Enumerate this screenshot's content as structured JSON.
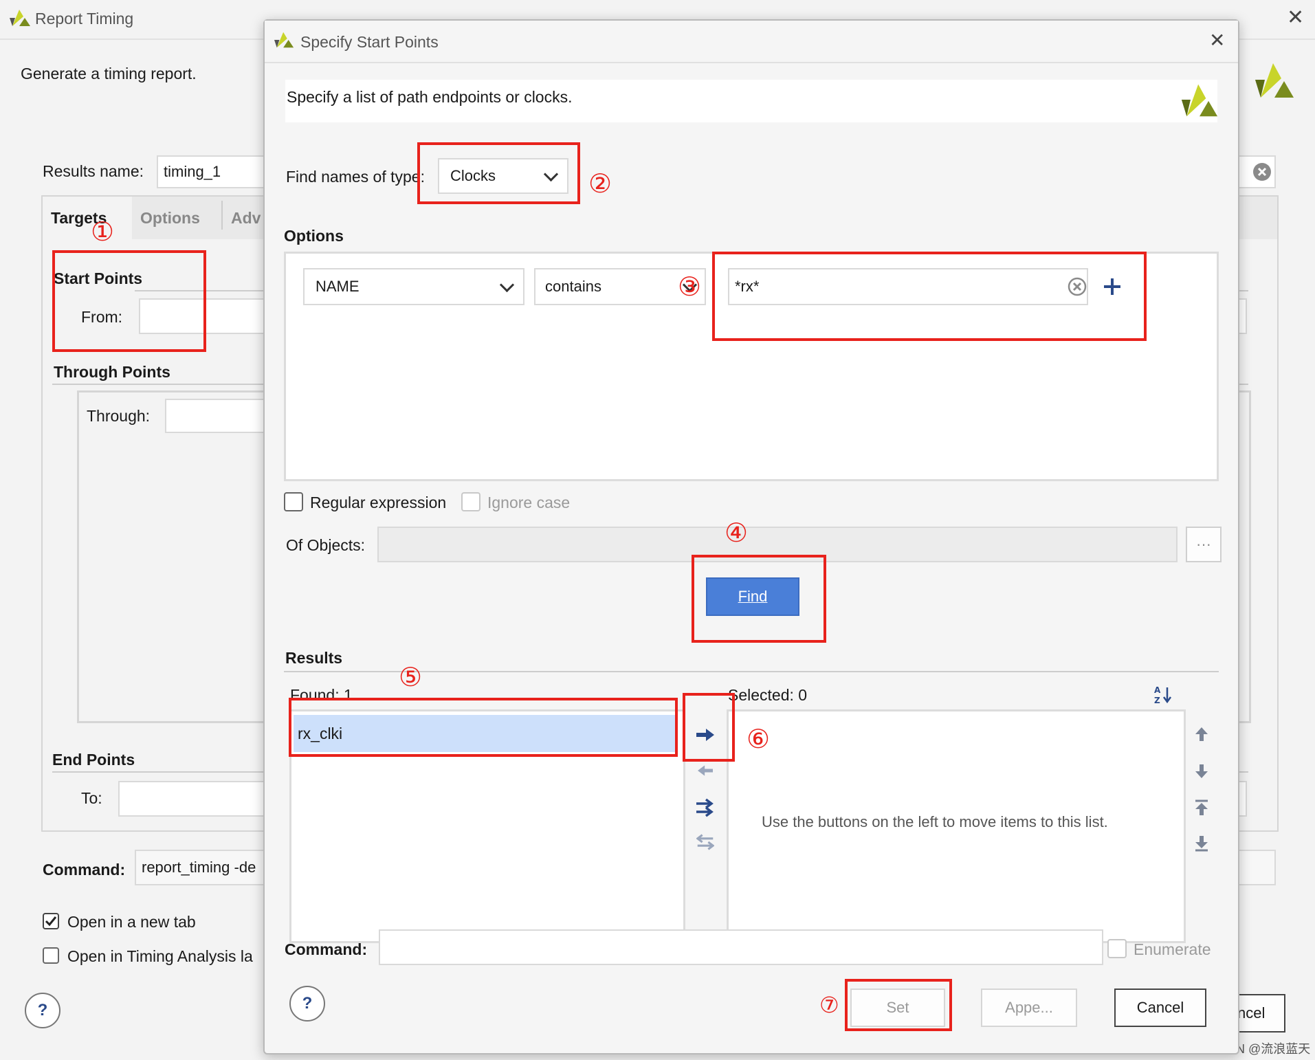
{
  "bg_dialog": {
    "title": "Report Timing",
    "description": "Generate a timing report.",
    "results_name_label": "Results name:",
    "results_name_value": "timing_1",
    "tabs": [
      {
        "label": "Targets"
      },
      {
        "label": "Options"
      },
      {
        "label": "Adv"
      }
    ],
    "start_points_heading": "Start Points",
    "from_label": "From:",
    "through_points_heading": "Through Points",
    "through_label": "Through:",
    "end_points_heading": "End Points",
    "to_label": "To:",
    "command_label": "Command:",
    "command_value": "report_timing -de",
    "open_new_tab_label": "Open in a new tab",
    "open_new_tab_checked": true,
    "open_timing_label": "Open in Timing Analysis la",
    "open_timing_checked": false,
    "help_label": "?",
    "cancel_label": "ncel"
  },
  "dialog": {
    "title": "Specify Start Points",
    "description": "Specify a list of path endpoints or clocks.",
    "find_type_label": "Find names of type:",
    "find_type_value": "Clocks",
    "options_heading": "Options",
    "property_value": "NAME",
    "operator_value": "contains",
    "pattern_value": "*rx*",
    "regex_label": "Regular expression",
    "ignore_case_label": "Ignore case",
    "of_objects_label": "Of Objects:",
    "of_objects_browse": "···",
    "find_label": "Find",
    "results_heading": "Results",
    "found_label": "Found: 1",
    "found_items": [
      {
        "name": "rx_clki"
      }
    ],
    "selected_label": "Selected: 0",
    "selected_placeholder": "Use the buttons on the left to move items to this list.",
    "command_label": "Command:",
    "command_value": "",
    "enumerate_label": "Enumerate",
    "help_label": "?",
    "set_label": "Set",
    "append_label": "Appe...",
    "cancel_label": "Cancel"
  },
  "annotations": [
    "①",
    "②",
    "③",
    "④",
    "⑤",
    "⑥",
    "⑦"
  ],
  "watermark": "CSDN @流浪蓝天",
  "colors": {
    "accent": "#4a7fd8",
    "highlight": "#cde0fb",
    "annotation": "#e8221c",
    "logo_yellow": "#c8d42a",
    "logo_green": "#7a8c1e"
  }
}
